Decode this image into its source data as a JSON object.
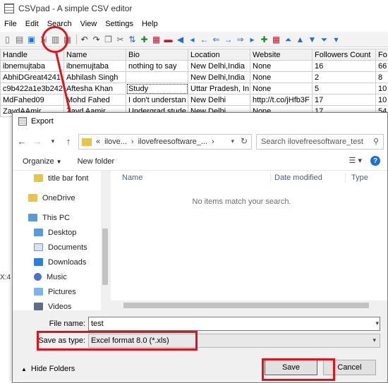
{
  "app": {
    "title": "CSVpad - A simple CSV editor",
    "menu": [
      "File",
      "Edit",
      "Search",
      "View",
      "Settings",
      "Help"
    ],
    "status": "X:4"
  },
  "toolbar_icons": [
    "new-file-icon",
    "open-file-icon",
    "save-icon",
    "export-icon",
    "save-as-icon",
    "print-icon",
    "undo-icon",
    "redo-icon",
    "copy-icon",
    "cut-icon",
    "sort-icon",
    "add-row-icon",
    "table-icon",
    "delete-row-icon",
    "nav-left-icon",
    "nav-left-icon",
    "nav-left-icon",
    "nav-left-icon",
    "nav-left-icon",
    "nav-right-icon",
    "nav-right-icon",
    "nav-right-icon",
    "add-column-icon",
    "grid-icon",
    "chevron-up-icon",
    "chevron-up-icon",
    "chevron-down-icon",
    "chevron-down-icon",
    "chevron-down-icon"
  ],
  "grid": {
    "headers": [
      "Handle",
      "Name",
      "Bio",
      "Location",
      "Website",
      "Followers Count",
      "Fo"
    ],
    "rows": [
      [
        "ibnemujtaba",
        "ibnemujtaba",
        "nothing to say",
        "New Delhi,India",
        "None",
        "16",
        "66"
      ],
      [
        "AbhiDGreat4241",
        "Abhilash Singh",
        "",
        "New Delhi,India",
        "None",
        "2",
        "8"
      ],
      [
        "c9b422a1e3b242",
        "Aftesha Khan",
        "Study",
        "Uttar Pradesh, In",
        "None",
        "5",
        "10"
      ],
      [
        "MdFahed09",
        "Mohd Fahed",
        "I don't understan",
        "New Delhi",
        "http://t.co/jHfb3F",
        "17",
        "10"
      ],
      [
        "ZaydAAmir",
        "Zayd Aamir",
        "Undergrad stude",
        "New Delhi",
        "None",
        "17",
        "54"
      ]
    ]
  },
  "dialog": {
    "title": "Export",
    "path": [
      "«",
      "ilove...",
      "›",
      "ilovefreesoftware_...",
      "›"
    ],
    "search_placeholder": "Search ilovefreesoftware_test",
    "organize": "Organize",
    "new_folder": "New folder",
    "nav_items": [
      {
        "label": "title bar font",
        "icon": "folder-icon"
      },
      {
        "label": "OneDrive",
        "icon": "folder-icon"
      },
      {
        "label": "This PC",
        "icon": "computer-icon"
      },
      {
        "label": "Desktop",
        "icon": "desktop-icon"
      },
      {
        "label": "Documents",
        "icon": "documents-icon"
      },
      {
        "label": "Downloads",
        "icon": "downloads-icon"
      },
      {
        "label": "Music",
        "icon": "music-icon"
      },
      {
        "label": "Pictures",
        "icon": "pictures-icon"
      },
      {
        "label": "Videos",
        "icon": "videos-icon"
      }
    ],
    "columns": {
      "name": "Name",
      "date": "Date modified",
      "type": "Type"
    },
    "empty_message": "No items match your search.",
    "file_name_label": "File name:",
    "file_name_value": "test",
    "save_type_label": "Save as type:",
    "save_type_value": "Excel format 8.0 (*.xls)",
    "hide_folders": "Hide Folders",
    "save": "Save",
    "cancel": "Cancel"
  },
  "colors": {
    "annotation_red": "#e3121a",
    "accent_blue": "#1a6fd8"
  }
}
